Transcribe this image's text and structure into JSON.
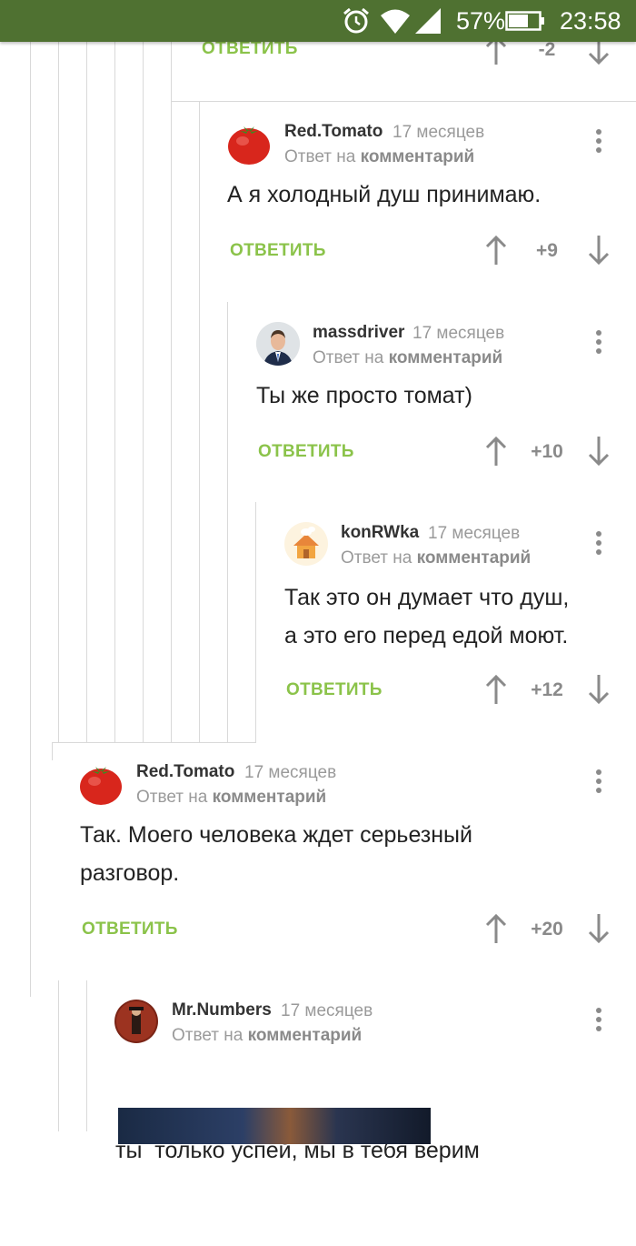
{
  "statusbar": {
    "battery_percent": "57%",
    "time": "23:58",
    "icons": [
      "alarm-icon",
      "wifi-icon",
      "signal-icon",
      "battery-icon"
    ]
  },
  "colors": {
    "statusbar_bg": "#4f7131",
    "reply_green": "#8bc34a",
    "meta_gray": "#9a9a9a",
    "thread_line": "#d9d9d9"
  },
  "top_partial": {
    "reply_label": "ОТВЕТИТЬ",
    "score": "-2"
  },
  "comments": [
    {
      "author": "Red.Tomato",
      "time": "17 месяцев",
      "reply_prefix": "Ответ на",
      "reply_link": "комментарий",
      "lines": [
        "А я холодный душ принимаю."
      ],
      "reply_label": "ОТВЕТИТЬ",
      "score": "+9",
      "avatar": "tomato-avatar"
    },
    {
      "author": "massdriver",
      "time": "17 месяцев",
      "reply_prefix": "Ответ на",
      "reply_link": "комментарий",
      "lines": [
        "Ты же просто томат)"
      ],
      "reply_label": "ОТВЕТИТЬ",
      "score": "+10",
      "avatar": "man-in-suit-avatar"
    },
    {
      "author": "konRWka",
      "time": "17 месяцев",
      "reply_prefix": "Ответ на",
      "reply_link": "комментарий",
      "lines": [
        "Так это он думает что душ,",
        "а это его перед едой моют."
      ],
      "reply_label": "ОТВЕТИТЬ",
      "score": "+12",
      "avatar": "cartoon-house-avatar"
    },
    {
      "author": "Red.Tomato",
      "time": "17 месяцев",
      "reply_prefix": "Ответ на",
      "reply_link": "комментарий",
      "lines": [
        "Так. Моего человека ждет серьезный",
        "разговор."
      ],
      "reply_label": "ОТВЕТИТЬ",
      "score": "+20",
      "avatar": "tomato-avatar"
    },
    {
      "author": "Mr.Numbers",
      "time": "17 месяцев",
      "reply_prefix": "Ответ на",
      "reply_link": "комментарий",
      "lines": [
        "ты  только успей, мы в тебя верим"
      ],
      "avatar": "figure-red-avatar"
    }
  ]
}
